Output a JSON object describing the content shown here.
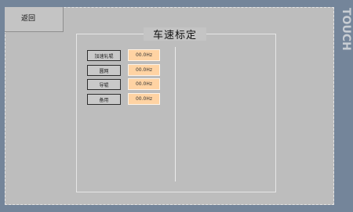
{
  "header": {
    "back_label": "返回",
    "touch_label": "TOUCH"
  },
  "panel": {
    "title": "车速标定"
  },
  "rows": [
    {
      "label": "加速轧辊",
      "value": "00.0Hz"
    },
    {
      "label": "圆网",
      "value": "00.0Hz"
    },
    {
      "label": "导辊",
      "value": "00.0Hz"
    },
    {
      "label": "备用",
      "value": "00.0Hz"
    }
  ]
}
